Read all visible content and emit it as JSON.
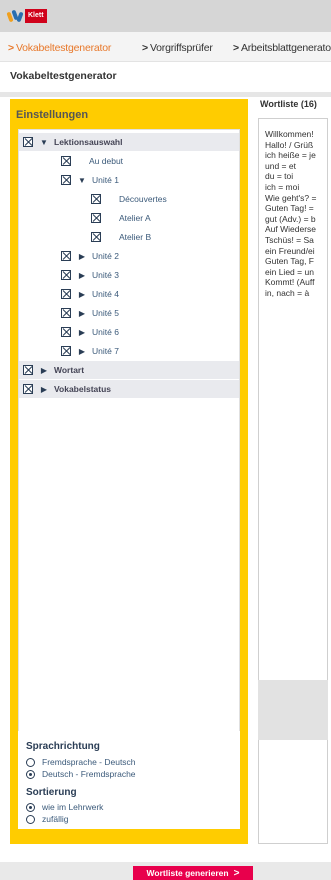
{
  "brand": {
    "logo_text": "Klett"
  },
  "nav": [
    {
      "label": "Vokabeltestgenerator",
      "active": true
    },
    {
      "label": "Vorgriffsprüfer",
      "active": false
    },
    {
      "label": "Arbeitsblattgenerator",
      "active": false
    }
  ],
  "page_title": "Vokabeltestgenerator",
  "settings": {
    "header": "Einstellungen",
    "tree": {
      "lektionsauswahl": "Lektionsauswahl",
      "au_debut": "Au debut",
      "unite1": "Unité 1",
      "decouvertes": "Découvertes",
      "atelier_a": "Atelier A",
      "atelier_b": "Atelier B",
      "unite2": "Unité 2",
      "unite3": "Unité 3",
      "unite4": "Unité 4",
      "unite5": "Unité 5",
      "unite6": "Unité 6",
      "unite7": "Unité 7",
      "wortart": "Wortart",
      "vokabelstatus": "Vokabelstatus"
    },
    "sprachrichtung": {
      "heading": "Sprachrichtung",
      "options": [
        "Fremdsprache - Deutsch",
        "Deutsch - Fremdsprache"
      ],
      "selected": "Deutsch - Fremdsprache"
    },
    "sortierung": {
      "heading": "Sortierung",
      "options": [
        "wie im Lehrwerk",
        "zufällig"
      ],
      "selected": "wie im Lehrwerk"
    }
  },
  "wortliste": {
    "title": "Wortliste (16)",
    "lines": [
      "Willkommen!",
      "Hallo! / Grüß",
      "ich heiße = je",
      "und = et",
      "du = toi",
      "ich = moi",
      "Wie geht's? =",
      "Guten Tag! =",
      "gut (Adv.) = b",
      "Auf Wiederse",
      "Tschüs! = Sa",
      "ein Freund/ei",
      "Guten Tag, F",
      "ein Lied = un",
      "Kommt! (Auff",
      "in, nach = à"
    ]
  },
  "generate_button": "Wortliste generieren"
}
